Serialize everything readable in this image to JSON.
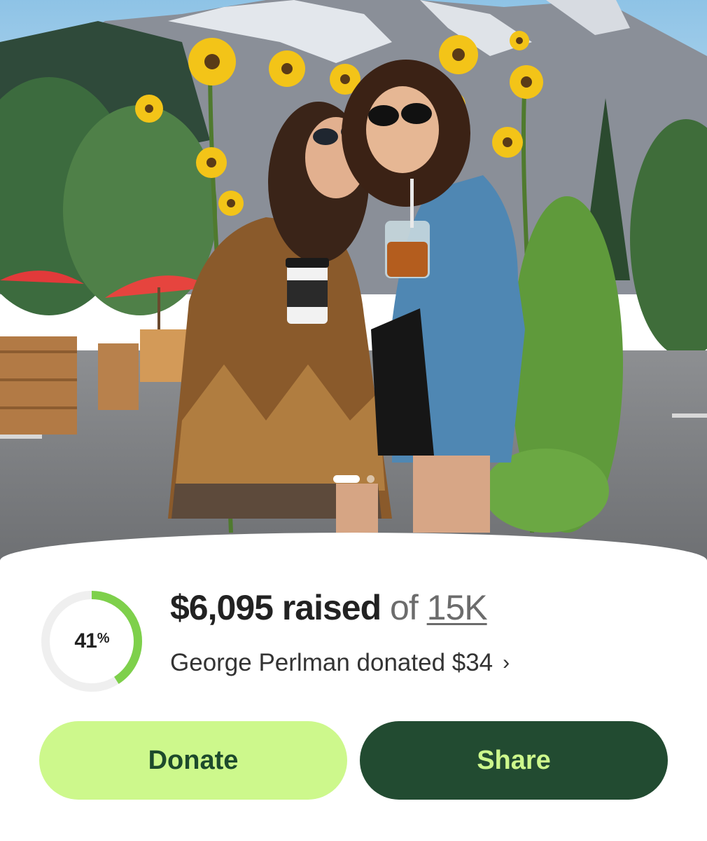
{
  "carousel": {
    "total_slides": 2,
    "active_slide": 1
  },
  "fundraiser": {
    "progress_fraction": 0.41,
    "percent_number": "41",
    "percent_sign": "%",
    "raised_amount": "$6,095 raised",
    "of_text": "of",
    "goal": "15K",
    "recent_donation": "George Perlman donated $34",
    "chevron": "›"
  },
  "actions": {
    "donate_label": "Donate",
    "share_label": "Share"
  },
  "colors": {
    "progress_green": "#7ed04b",
    "ring_track": "#efefef",
    "donate_bg": "#cdf88c",
    "share_bg": "#224b31",
    "share_text": "#cdf88c",
    "donate_text": "#1d4a2c"
  }
}
